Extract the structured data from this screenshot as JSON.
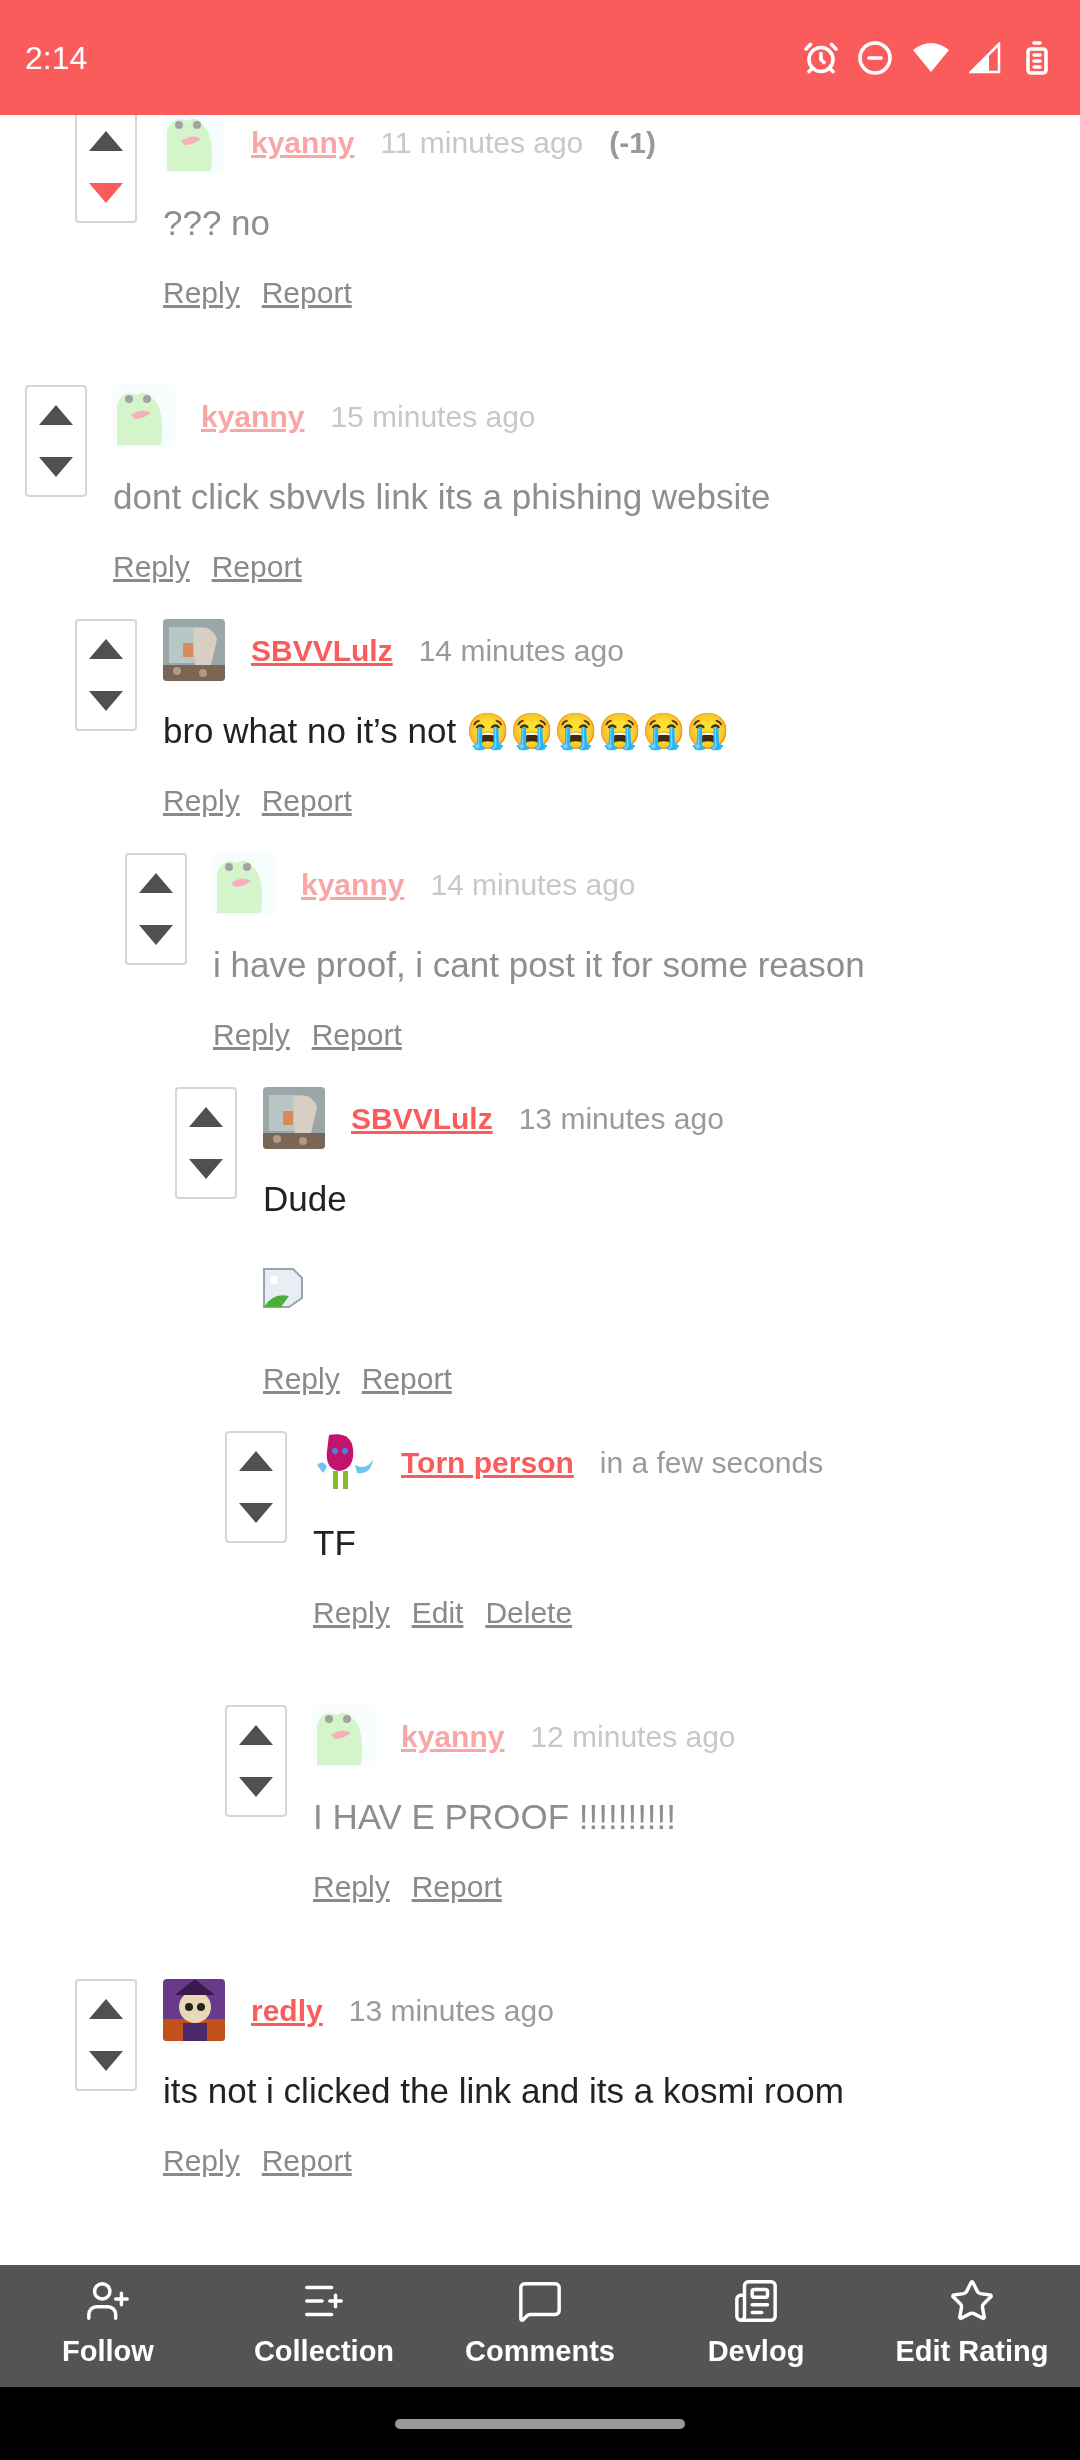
{
  "status_bar": {
    "time": "2:14"
  },
  "comments": [
    {
      "kind": "continued",
      "children": [
        {
          "kind": "comment",
          "author": "kyanny",
          "time": "11 minutes ago",
          "score": "(-1)",
          "faded": true,
          "downvoted": true,
          "body": "??? no",
          "actions": [
            "Reply",
            "Report"
          ]
        }
      ]
    },
    {
      "kind": "comment",
      "author": "kyanny",
      "time": "15 minutes ago",
      "faded": true,
      "downvoted": false,
      "body": "dont click sbvvls link its a phishing website",
      "actions": [
        "Reply",
        "Report"
      ],
      "children": [
        {
          "kind": "comment",
          "author": "SBVVLulz",
          "time": "14 minutes ago",
          "faded": false,
          "downvoted": false,
          "body": "bro what no it’s not 😭😭😭😭😭😭",
          "actions": [
            "Reply",
            "Report"
          ],
          "children": [
            {
              "kind": "comment",
              "author": "kyanny",
              "time": "14 minutes ago",
              "faded": true,
              "downvoted": false,
              "body": "i have proof, i cant post it for some reason",
              "actions": [
                "Reply",
                "Report"
              ],
              "children": [
                {
                  "kind": "comment",
                  "author": "SBVVLulz",
                  "time": "13 minutes ago",
                  "faded": false,
                  "downvoted": false,
                  "body": "Dude",
                  "attachment": {
                    "kind": "broken_image"
                  },
                  "actions": [
                    "Reply",
                    "Report"
                  ],
                  "children": [
                    {
                      "kind": "comment",
                      "author": "Torn person",
                      "time": "in a few seconds",
                      "faded": false,
                      "downvoted": false,
                      "body": "TF",
                      "actions": [
                        "Reply",
                        "Edit",
                        "Delete"
                      ]
                    },
                    {
                      "kind": "comment",
                      "author": "kyanny",
                      "time": "12 minutes ago",
                      "faded": true,
                      "downvoted": false,
                      "body": "I HAV E PROOF !!!!!!!!!!",
                      "actions": [
                        "Reply",
                        "Report"
                      ]
                    }
                  ]
                }
              ]
            }
          ]
        },
        {
          "kind": "comment",
          "author": "redly",
          "time": "13 minutes ago",
          "faded": false,
          "downvoted": false,
          "body": "its not i clicked the link and its a kosmi room",
          "actions": [
            "Reply",
            "Report"
          ]
        }
      ]
    }
  ],
  "bottom_nav": [
    {
      "label": "Follow"
    },
    {
      "label": "Collection"
    },
    {
      "label": "Comments"
    },
    {
      "label": "Devlog"
    },
    {
      "label": "Edit Rating"
    }
  ]
}
